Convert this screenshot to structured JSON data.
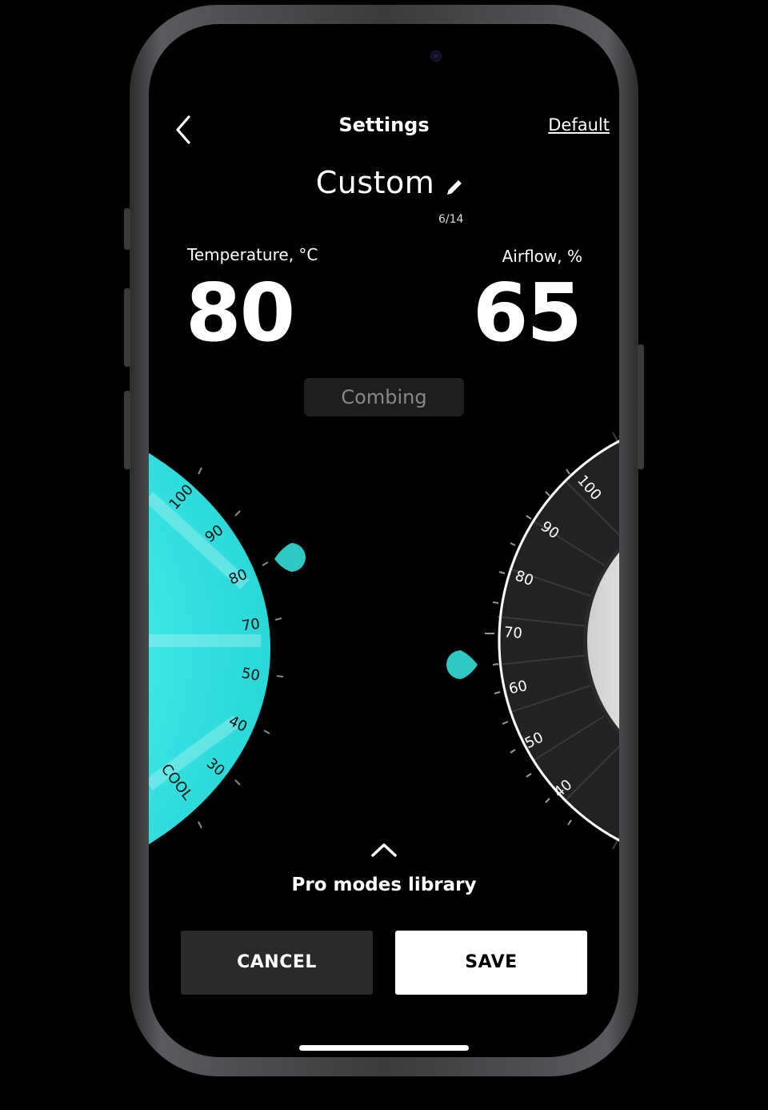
{
  "header": {
    "back_icon": "chevron-left-icon",
    "title": "Settings",
    "default_label": "Default"
  },
  "mode": {
    "name": "Custom",
    "edit_icon": "pencil-icon",
    "char_count": "6/14"
  },
  "readouts": {
    "temperature_label": "Temperature, °C",
    "temperature_value": "80",
    "airflow_label": "Airflow, %",
    "airflow_value": "65"
  },
  "style_chip": "Combing",
  "temperature_dial": {
    "ticks": [
      "100",
      "90",
      "80",
      "70",
      "50",
      "40",
      "30"
    ],
    "cool_label": "COOL",
    "selected": 80,
    "colors": {
      "fill": "#35e8e6",
      "handle": "#2ec9c2"
    }
  },
  "airflow_dial": {
    "ticks": [
      "100",
      "90",
      "80",
      "70",
      "60",
      "50",
      "40"
    ],
    "selected": 65,
    "colors": {
      "handle": "#2ec9c2"
    }
  },
  "library": {
    "icon": "chevron-up-icon",
    "label": "Pro modes library"
  },
  "actions": {
    "cancel_label": "CANCEL",
    "save_label": "SAVE"
  }
}
